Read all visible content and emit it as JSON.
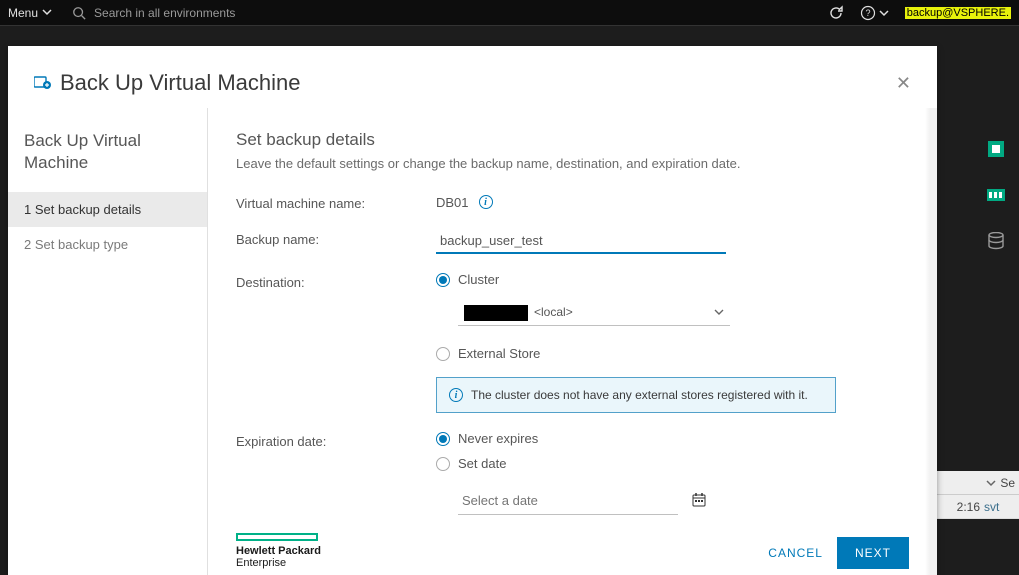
{
  "topbar": {
    "menu_label": "Menu",
    "search_placeholder": "Search in all environments",
    "user_label": "backup@VSPHERE."
  },
  "modal": {
    "title": "Back Up Virtual Machine"
  },
  "wizard": {
    "title": "Back Up Virtual Machine",
    "steps": [
      {
        "num": "1",
        "label": "Set backup details"
      },
      {
        "num": "2",
        "label": "Set backup type"
      }
    ]
  },
  "form": {
    "heading": "Set backup details",
    "description": "Leave the default settings or change the backup name, destination, and expiration date.",
    "vm_name_label": "Virtual machine name:",
    "vm_name_value": "DB01",
    "backup_name_label": "Backup name:",
    "backup_name_value": "backup_user_test",
    "destination_label": "Destination:",
    "dest_cluster_label": "Cluster",
    "dest_select_value": "<local>",
    "dest_external_label": "External Store",
    "dest_alert": "The cluster does not have any external stores registered with it.",
    "expiration_label": "Expiration date:",
    "exp_never_label": "Never expires",
    "exp_set_label": "Set date",
    "date_placeholder": "Select a date"
  },
  "brand": {
    "line1": "Hewlett Packard",
    "line2": "Enterprise"
  },
  "buttons": {
    "cancel": "CANCEL",
    "next": "NEXT"
  },
  "bg": {
    "col_header": "Se",
    "row_time": "2:16",
    "row_link": "svt"
  }
}
